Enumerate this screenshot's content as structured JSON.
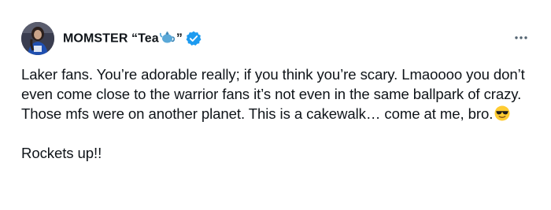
{
  "tweet": {
    "author": {
      "name_prefix": "MOMSTER “Tea",
      "name_suffix": "”",
      "name_emoji": "teapot-emoji",
      "verified": true,
      "verified_color": "#1d9bf0"
    },
    "more_label": "···",
    "text": {
      "paragraph1": "Laker fans. You’re adorable really; if you think you’re scary. Lmaoooo you don’t even come close to the warrior fans it’s not even in the same ballpark of crazy. Those mfs were on another planet. This is a cakewalk… come at me, bro.",
      "paragraph1_emoji": "sunglasses-emoji",
      "paragraph2": "Rockets up!!"
    }
  }
}
